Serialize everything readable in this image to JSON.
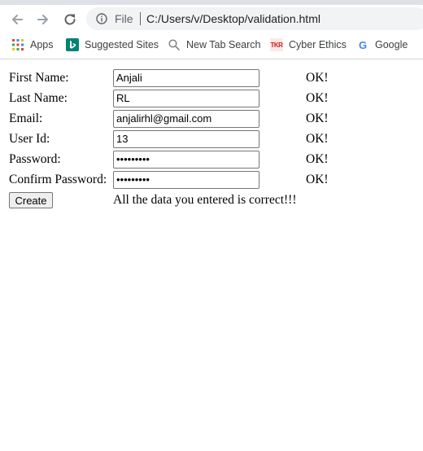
{
  "browser": {
    "omnibox": {
      "scheme_label": "File",
      "url": "C:/Users/v/Desktop/validation.html"
    },
    "bookmarks": [
      {
        "label": "Apps",
        "icon": "apps-grid-icon"
      },
      {
        "label": "Suggested Sites",
        "icon": "bing-icon"
      },
      {
        "label": "New Tab Search",
        "icon": "search-icon"
      },
      {
        "label": "Cyber Ethics",
        "icon": "tkr-icon",
        "icon_text": "TKR"
      },
      {
        "label": "Google",
        "icon": "google-icon",
        "icon_text": "G"
      }
    ]
  },
  "form": {
    "fields": [
      {
        "label": "First Name:",
        "value": "Anjali",
        "status": "OK!"
      },
      {
        "label": "Last Name:",
        "value": "RL",
        "status": "OK!"
      },
      {
        "label": "Email:",
        "value": "anjalirhl@gmail.com",
        "status": "OK!"
      },
      {
        "label": "User Id:",
        "value": "13",
        "status": "OK!"
      },
      {
        "label": "Password:",
        "value": "•••••••••",
        "status": "OK!"
      },
      {
        "label": "Confirm Password:",
        "value": "•••••••••",
        "status": "OK!"
      }
    ],
    "create_button": "Create",
    "result_message": "All the data you entered is correct!!!"
  }
}
